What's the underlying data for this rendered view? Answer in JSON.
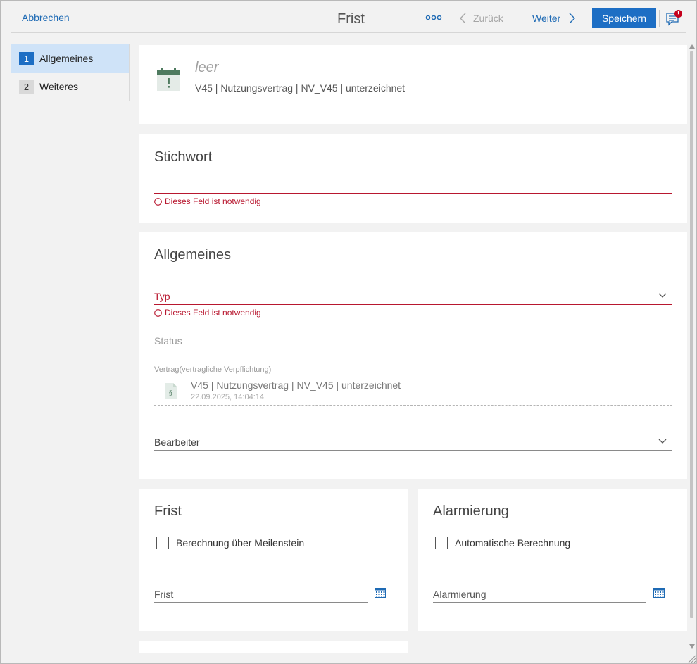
{
  "topbar": {
    "cancel_label": "Abbrechen",
    "title": "Frist",
    "more_icon": "more-dots-icon",
    "back_label": "Zurück",
    "next_label": "Weiter",
    "save_label": "Speichern",
    "comment_badge": "!"
  },
  "sidebar": {
    "items": [
      {
        "num": "1",
        "label": "Allgemeines",
        "active": true
      },
      {
        "num": "2",
        "label": "Weiteres",
        "active": false
      }
    ]
  },
  "header": {
    "empty_text": "leer",
    "subtitle": "V45 | Nutzungsvertrag | NV_V45 | unterzeichnet",
    "icon": "calendar-alert-icon"
  },
  "stichwort": {
    "title": "Stichwort",
    "error": "Dieses Feld ist notwendig"
  },
  "allgemeines": {
    "title": "Allgemeines",
    "typ_label": "Typ",
    "typ_error": "Dieses Feld ist notwendig",
    "status_label": "Status",
    "contract_label": "Vertrag(vertragliche Verpflichtung)",
    "contract_title": "V45 | Nutzungsvertrag | NV_V45 | unterzeichnet",
    "contract_date": "22.09.2025, 14:04:14",
    "bearbeiter_label": "Bearbeiter"
  },
  "frist": {
    "title": "Frist",
    "checkbox_label": "Berechnung über Meilenstein",
    "date_label": "Frist"
  },
  "alarmierung": {
    "title": "Alarmierung",
    "checkbox_label": "Automatische Berechnung",
    "date_label": "Alarmierung"
  },
  "colors": {
    "accent": "#1d6ec4",
    "error": "#b8172f",
    "active_nav": "#cfe3f8"
  }
}
